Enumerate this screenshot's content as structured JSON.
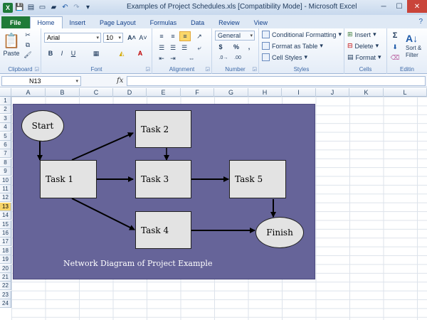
{
  "window": {
    "title": "Examples of Project Schedules.xls  [Compatibility Mode]  -  Microsoft Excel"
  },
  "tabs": [
    {
      "label": "File"
    },
    {
      "label": "Home"
    },
    {
      "label": "Insert"
    },
    {
      "label": "Page Layout"
    },
    {
      "label": "Formulas"
    },
    {
      "label": "Data"
    },
    {
      "label": "Review"
    },
    {
      "label": "View"
    }
  ],
  "active_tab": "Home",
  "ribbon": {
    "clipboard": {
      "label": "Clipboard",
      "paste": "Paste"
    },
    "font": {
      "label": "Font",
      "name": "Arial",
      "size": "10",
      "bold": "B",
      "italic": "I",
      "underline": "U"
    },
    "alignment": {
      "label": "Alignment"
    },
    "number": {
      "label": "Number",
      "format": "General",
      "currency": "$",
      "percent": "%",
      "comma": ","
    },
    "styles": {
      "label": "Styles",
      "conditional": "Conditional Formatting",
      "format_table": "Format as Table",
      "cell_styles": "Cell Styles"
    },
    "cells": {
      "label": "Cells",
      "insert": "Insert",
      "delete": "Delete",
      "format": "Format"
    },
    "editing": {
      "label": "Editin",
      "sigma": "Σ",
      "sort": "Sort &",
      "filter": "Filter"
    }
  },
  "formula_bar": {
    "name_box": "N13",
    "fx": "fx",
    "value": ""
  },
  "columns": [
    "A",
    "B",
    "C",
    "D",
    "E",
    "F",
    "G",
    "H",
    "I",
    "J",
    "K",
    "L"
  ],
  "rows": [
    "1",
    "2",
    "3",
    "4",
    "5",
    "6",
    "7",
    "8",
    "9",
    "10",
    "11",
    "12",
    "13",
    "14",
    "15",
    "16",
    "17",
    "18",
    "19",
    "20",
    "21",
    "22",
    "23",
    "24"
  ],
  "selected_row": "13",
  "diagram": {
    "start": "Start",
    "task1": "Task 1",
    "task2": "Task 2",
    "task3": "Task 3",
    "task4": "Task 4",
    "task5": "Task 5",
    "finish": "Finish",
    "caption": "Network Diagram of Project Example",
    "background": "#666499",
    "node_fill": "#e3e3e3"
  }
}
